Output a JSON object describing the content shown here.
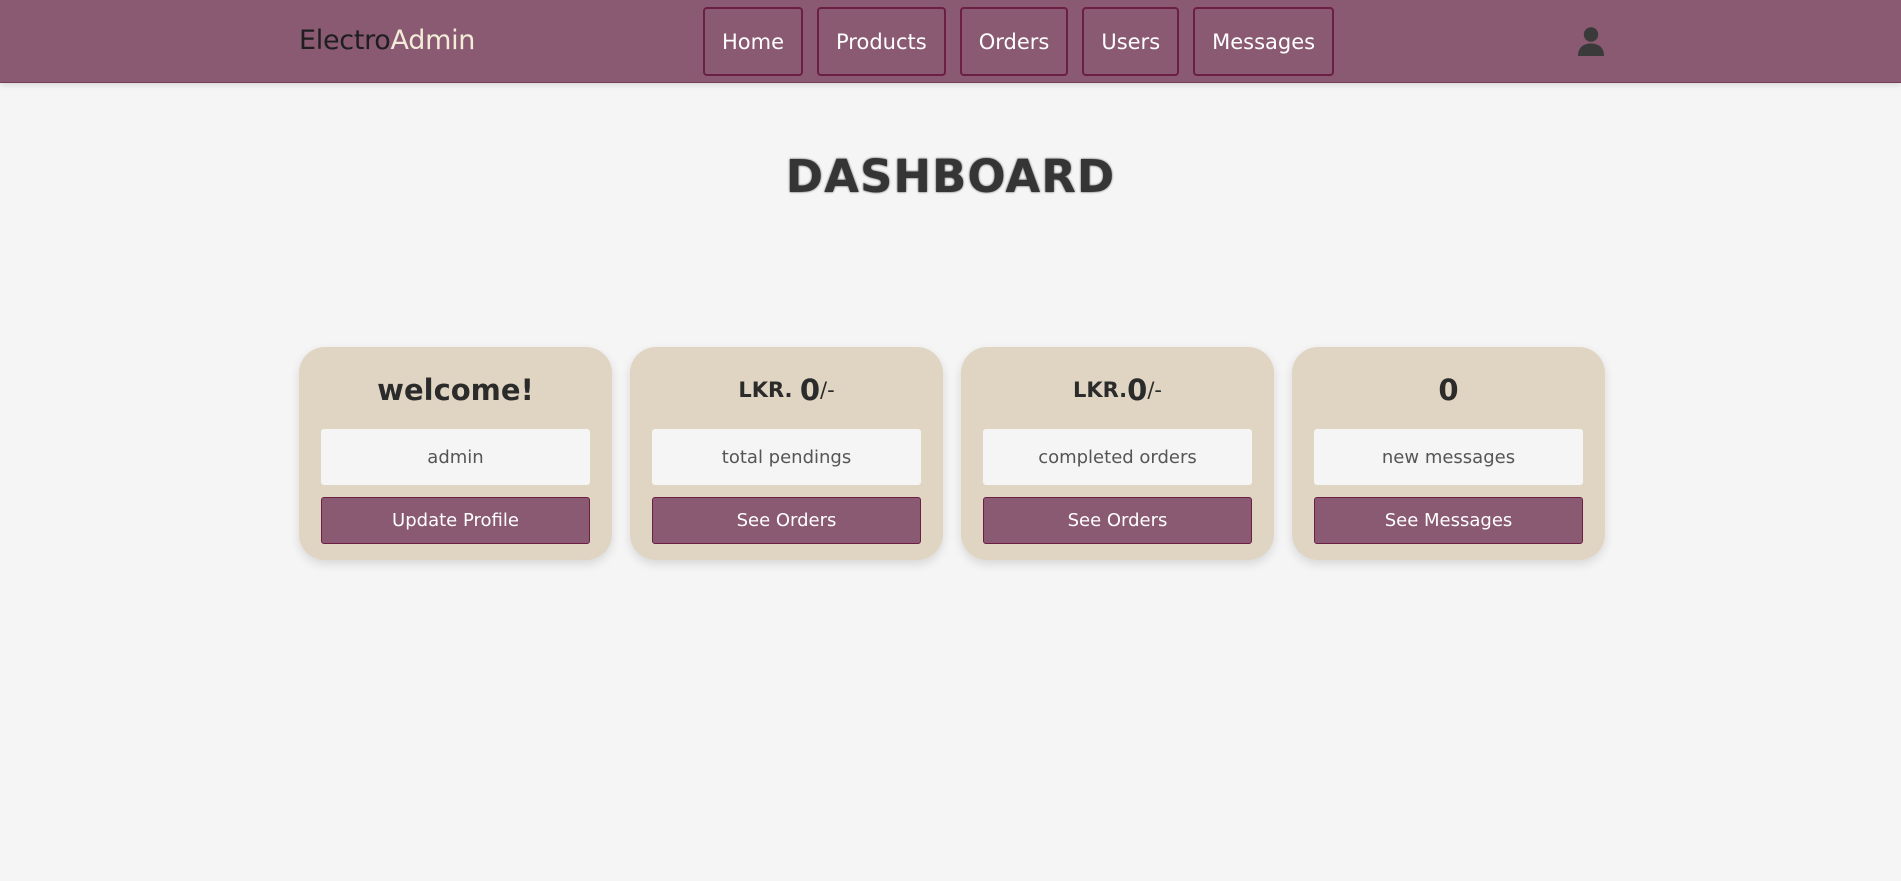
{
  "header": {
    "logo_part1": "Electro",
    "logo_part2": "Admin",
    "nav": [
      "Home",
      "Products",
      "Orders",
      "Users",
      "Messages"
    ],
    "user_icon": "user-icon"
  },
  "main": {
    "title": "DASHBOARD"
  },
  "cards": [
    {
      "prefix": "",
      "value": "welcome!",
      "suffix": "",
      "info": "admin",
      "button": "Update Profile"
    },
    {
      "prefix": "LKR. ",
      "value": "0",
      "suffix": "/-",
      "info": "total pendings",
      "button": "See Orders"
    },
    {
      "prefix": "LKR.",
      "value": "0",
      "suffix": "/-",
      "info": "completed orders",
      "button": "See Orders"
    },
    {
      "prefix": "",
      "value": "0",
      "suffix": "",
      "info": "new messages",
      "button": "See Messages"
    }
  ],
  "colors": {
    "header_bg": "#8a5a73",
    "nav_border": "#6b1f42",
    "card_bg": "#e0d5c3",
    "page_bg": "#f5f5f5",
    "logo_accent": "#f3ecd9"
  }
}
